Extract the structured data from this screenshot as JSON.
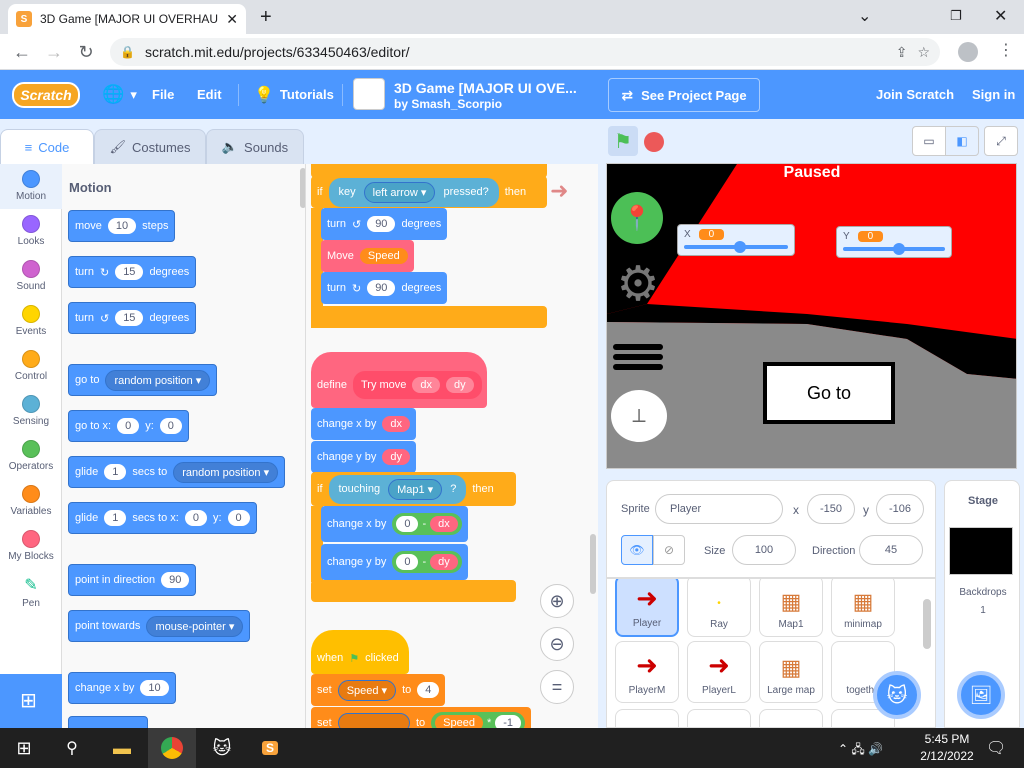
{
  "browser": {
    "tab_title": "3D Game [MAJOR UI OVERHAUL",
    "url": "scratch.mit.edu/projects/633450463/editor/"
  },
  "menubar": {
    "file": "File",
    "edit": "Edit",
    "tutorials": "Tutorials",
    "project_title": "3D Game [MAJOR UI OVE...",
    "author": "by Smash_Scorpio",
    "see_project": "See Project Page",
    "join": "Join Scratch",
    "signin": "Sign in"
  },
  "editor_tabs": [
    "Code",
    "Costumes",
    "Sounds"
  ],
  "categories": [
    {
      "label": "Motion",
      "color": "#4c97ff"
    },
    {
      "label": "Looks",
      "color": "#9966ff"
    },
    {
      "label": "Sound",
      "color": "#cf63cf"
    },
    {
      "label": "Events",
      "color": "#ffd500"
    },
    {
      "label": "Control",
      "color": "#ffab19"
    },
    {
      "label": "Sensing",
      "color": "#5cb1d6"
    },
    {
      "label": "Operators",
      "color": "#59c059"
    },
    {
      "label": "Variables",
      "color": "#ff8c1a"
    },
    {
      "label": "My Blocks",
      "color": "#ff6680"
    },
    {
      "label": "Pen",
      "color": "#0fbd8c"
    }
  ],
  "palette": {
    "heading": "Motion",
    "move": [
      "move",
      "10",
      "steps"
    ],
    "turn_r": [
      "turn",
      "15",
      "degrees"
    ],
    "turn_l": [
      "turn",
      "15",
      "degrees"
    ],
    "goto": [
      "go to",
      "random position"
    ],
    "gotoxy": [
      "go to x:",
      "0",
      "y:",
      "0"
    ],
    "glide1": [
      "glide",
      "1",
      "secs to",
      "random position"
    ],
    "glide2": [
      "glide",
      "1",
      "secs to x:",
      "0",
      "y:",
      "0"
    ],
    "point_dir": [
      "point in direction",
      "90"
    ],
    "point_towards": [
      "point towards",
      "mouse-pointer"
    ],
    "change_x": [
      "change x by",
      "10"
    ]
  },
  "script": {
    "if1": [
      "if",
      "key",
      "left arrow",
      "pressed?",
      "then"
    ],
    "turn1": [
      "turn",
      "90",
      "degrees"
    ],
    "move_speed": [
      "Move",
      "Speed"
    ],
    "turn2": [
      "turn",
      "90",
      "degrees"
    ],
    "define": [
      "define",
      "Try move",
      "dx",
      "dy"
    ],
    "cxby": [
      "change x by",
      "dx"
    ],
    "cyby": [
      "change y by",
      "dy"
    ],
    "if2": [
      "if",
      "touching",
      "Map1",
      "?",
      "then"
    ],
    "cx2": [
      "change x by",
      "0",
      "-",
      "dx"
    ],
    "cy2": [
      "change y by",
      "0",
      "-",
      "dy"
    ],
    "hat": [
      "when",
      "clicked"
    ],
    "set1": [
      "set",
      "Speed",
      "to",
      "4"
    ],
    "set2": [
      "set",
      "to",
      "Speed",
      "*",
      "-1"
    ]
  },
  "stage": {
    "paused": "Paused",
    "x_label": "X",
    "x_value": "0",
    "y_label": "Y",
    "y_value": "0",
    "goto_button": "Go to",
    "colors": {
      "sky": "#ff0000",
      "wall": "#000000",
      "floor": "#808080"
    }
  },
  "sprite_info": {
    "sprite_label": "Sprite",
    "sprite_name": "Player",
    "x_label": "x",
    "x": "-150",
    "y_label": "y",
    "y": "-106",
    "size_label": "Size",
    "size": "100",
    "direction_label": "Direction",
    "direction": "45"
  },
  "sprites": [
    "Player",
    "Ray",
    "Map1",
    "minimap",
    "PlayerM",
    "PlayerL",
    "Large map",
    "togethe"
  ],
  "stage_panel": {
    "title": "Stage",
    "backdrops_label": "Backdrops",
    "backdrops_count": "1"
  },
  "taskbar": {
    "time": "5:45 PM",
    "date": "2/12/2022"
  }
}
